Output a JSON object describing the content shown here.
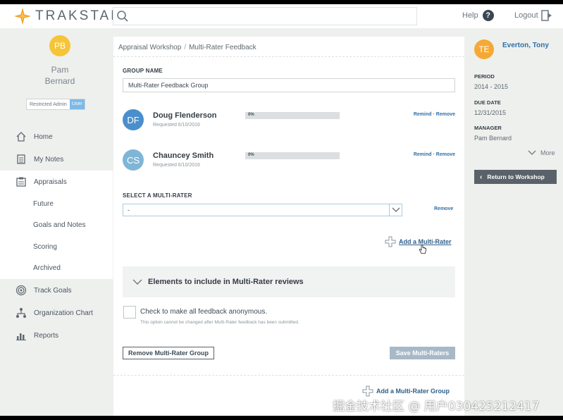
{
  "app": {
    "brand": "TRAKSTAR"
  },
  "header": {
    "search_placeholder": "",
    "help_label": "Help",
    "help_icon": "?",
    "logout_label": "Logout"
  },
  "user": {
    "initials": "PB",
    "first_name": "Pam",
    "last_name": "Bernard",
    "role": "Restricted Admin",
    "role_badge": "User"
  },
  "sidebar": {
    "items": [
      {
        "label": "Home",
        "icon": "home-icon"
      },
      {
        "label": "My Notes",
        "icon": "notes-icon"
      },
      {
        "label": "Appraisals",
        "icon": "appraisals-icon"
      },
      {
        "label": "Track Goals",
        "icon": "target-icon"
      },
      {
        "label": "Organization Chart",
        "icon": "org-chart-icon"
      },
      {
        "label": "Reports",
        "icon": "reports-icon"
      }
    ],
    "sub_items": [
      "Future",
      "Goals and Notes",
      "Scoring",
      "Archived"
    ]
  },
  "main": {
    "breadcrumb": [
      "Appraisal Workshop",
      "Multi-Rater Feedback"
    ],
    "breadcrumb_sep": "/",
    "group_name_label": "GROUP NAME",
    "group_name_value": "Multi-Rater Feedback Group",
    "raters": [
      {
        "initials": "DF",
        "name": "Doug Flenderson",
        "requested": "Requested 6/10/2016",
        "progress_text": "0%",
        "progress": 0,
        "remind": "Remind",
        "remove": "Remove",
        "sep": " · ",
        "avatar_color": "#4a8fcb"
      },
      {
        "initials": "CS",
        "name": "Chauncey Smith",
        "requested": "Requested 6/10/2016",
        "progress_text": "0%",
        "progress": 0,
        "remind": "Remind",
        "remove": "Remove",
        "sep": " · ",
        "avatar_color": "#7fb6d8"
      }
    ],
    "select_label": "SELECT A MULTI-RATER",
    "select_value": "-",
    "select_remove": "Remove",
    "add_rater_label": "Add a Multi-Rater",
    "accordion_title": "Elements to include in Multi-Rater reviews",
    "anonymous_label": "Check to make all feedback anonymous.",
    "anonymous_note": "This option cannot be changed after Multi-Rater feedback has been submitted.",
    "remove_group_button": "Remove Multi-Rater Group",
    "save_button": "Save Multi-Raters",
    "add_group_label": "Add a Multi-Rater Group"
  },
  "employee": {
    "initials": "TE",
    "name": "Everton, Tony",
    "period_label": "PERIOD",
    "period_value": "2014 - 2015",
    "due_label": "DUE DATE",
    "due_value": "12/31/2015",
    "manager_label": "MANAGER",
    "manager_value": "Pam Bernard",
    "more_label": "More",
    "return_button": "Return to Workshop"
  },
  "watermark": "掘金技术社区 @ 用户030425212417",
  "colors": {
    "accent": "#f5a935",
    "link": "#2f6fa6",
    "brand_orange": "#f39a2b"
  }
}
